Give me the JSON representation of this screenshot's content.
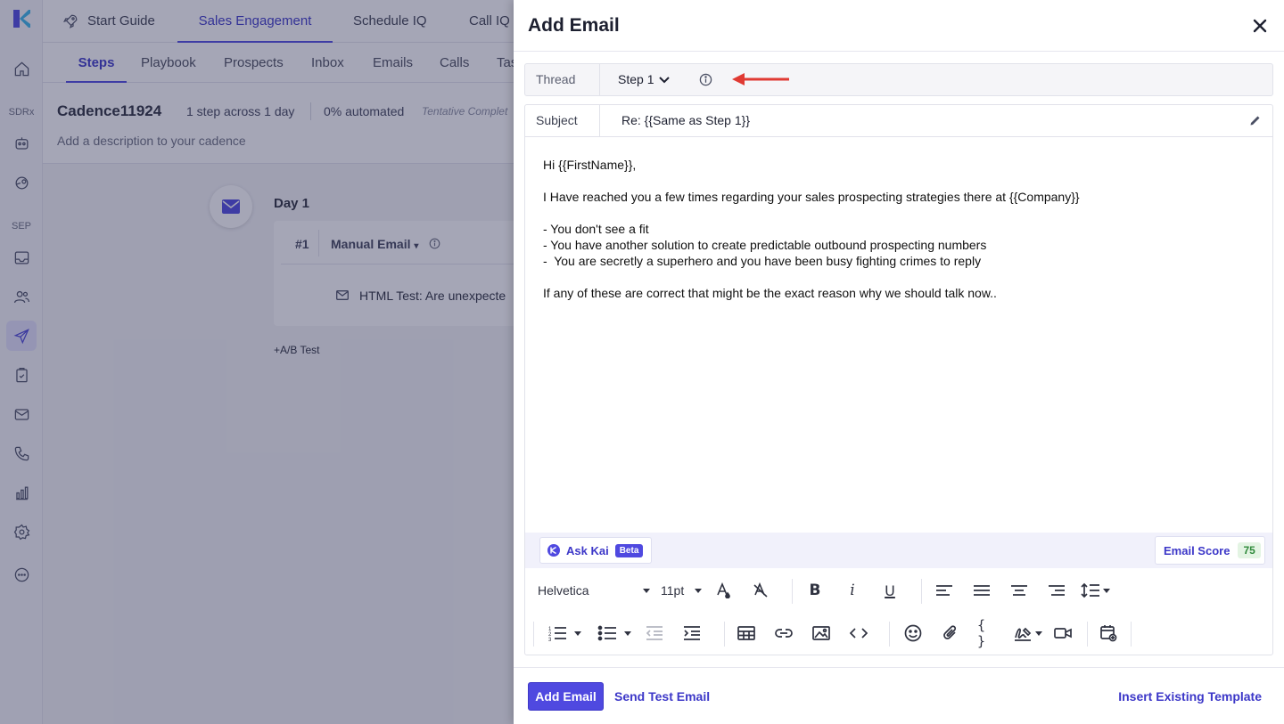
{
  "topnav": {
    "tabs": [
      {
        "label": "Start Guide"
      },
      {
        "label": "Sales Engagement"
      },
      {
        "label": "Schedule IQ"
      },
      {
        "label": "Call IQ"
      }
    ]
  },
  "sidebar": {
    "section_sdrx": "SDRx",
    "section_sep": "SEP"
  },
  "subnav": {
    "tabs": [
      {
        "label": "Steps"
      },
      {
        "label": "Playbook"
      },
      {
        "label": "Prospects"
      },
      {
        "label": "Inbox"
      },
      {
        "label": "Emails"
      },
      {
        "label": "Calls"
      },
      {
        "label": "Tas"
      }
    ]
  },
  "cadence": {
    "name": "Cadence11924",
    "steps_summary": "1 step across 1 day",
    "automated": "0% automated",
    "tentative": "Tentative Complet",
    "description_placeholder": "Add a description to your cadence",
    "day_label": "Day 1",
    "step_number": "#1",
    "step_type": "Manual Email",
    "step_subject": "HTML Test: Are unexpecte",
    "ab_test": "+A/B Test"
  },
  "modal": {
    "title": "Add Email",
    "thread_label": "Thread",
    "thread_value": "Step 1",
    "subject_label": "Subject",
    "subject_value": "Re: {{Same as Step 1}}",
    "body": {
      "line1": "Hi {{FirstName}},",
      "line2": "I Have reached you a few times regarding your sales prospecting strategies there at {{Company}}",
      "line3": "- You don't see a fit",
      "line4": "- You have another solution to create predictable outbound prospecting numbers",
      "line5": "-  You are secretly a superhero and you have been busy fighting crimes to reply",
      "line6": "If any of these are correct that might be the exact reason why we should talk now.."
    },
    "ask_kai": "Ask Kai",
    "beta": "Beta",
    "email_score_label": "Email Score",
    "email_score_value": "75",
    "font_family": "Helvetica",
    "font_size": "11pt",
    "add_email_button": "Add Email",
    "send_test_button": "Send Test Email",
    "insert_template_button": "Insert Existing Template"
  },
  "colors": {
    "accent": "#4f49e0",
    "annotation_arrow": "#e03a33",
    "score_green": "#2f8a3b"
  }
}
